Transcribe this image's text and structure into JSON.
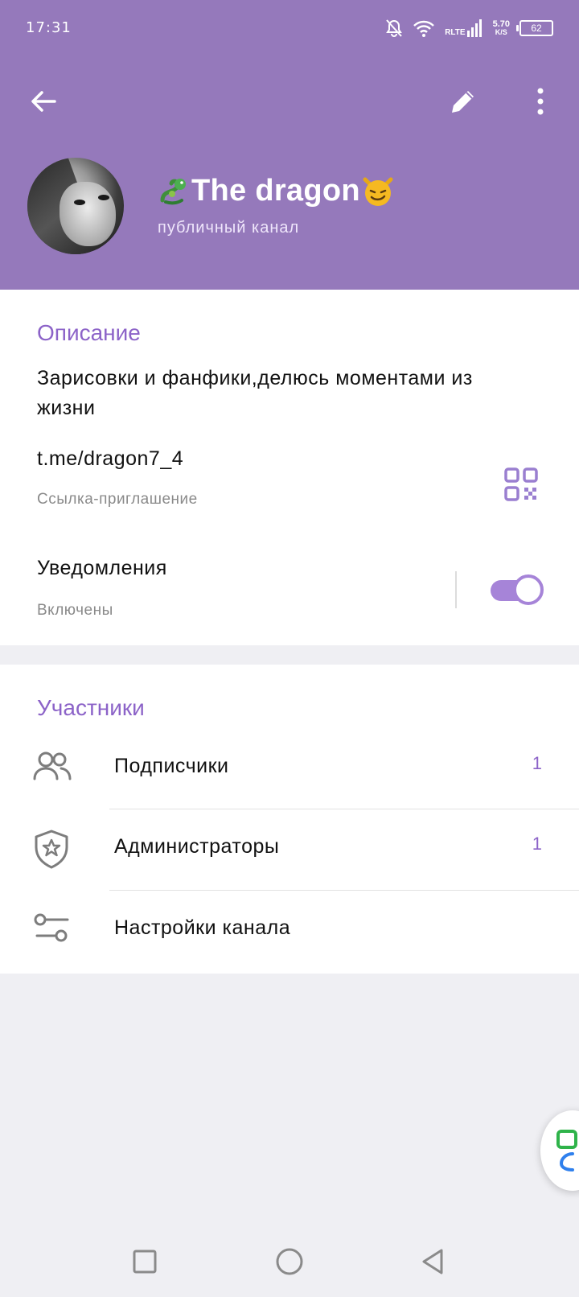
{
  "status": {
    "time": "17:31",
    "network": "RLTE",
    "speed_value": "5.70",
    "speed_unit": "K/S",
    "battery": "62"
  },
  "header": {
    "back_icon": "arrow-left-icon",
    "edit_icon": "pencil-icon",
    "more_icon": "more-vertical-icon",
    "title": "The dragon",
    "subtitle": "публичный канал",
    "accent_color": "#9579bb"
  },
  "info": {
    "section_title": "Описание",
    "description": "Зарисовки и фанфики,делюсь моментами из жизни",
    "link": "t.me/dragon7_4",
    "link_caption": "Ссылка-приглашение",
    "notifications_title": "Уведомления",
    "notifications_state": "Включены",
    "notifications_on": true
  },
  "members": {
    "section_title": "Участники",
    "rows": [
      {
        "label": "Подписчики",
        "count": "1",
        "icon": "people-icon"
      },
      {
        "label": "Администраторы",
        "count": "1",
        "icon": "shield-star-icon"
      },
      {
        "label": "Настройки канала",
        "count": "",
        "icon": "sliders-icon"
      }
    ]
  },
  "colors": {
    "accent_text": "#8c63c8",
    "toggle": "#a684d8",
    "background": "#efeff3"
  }
}
